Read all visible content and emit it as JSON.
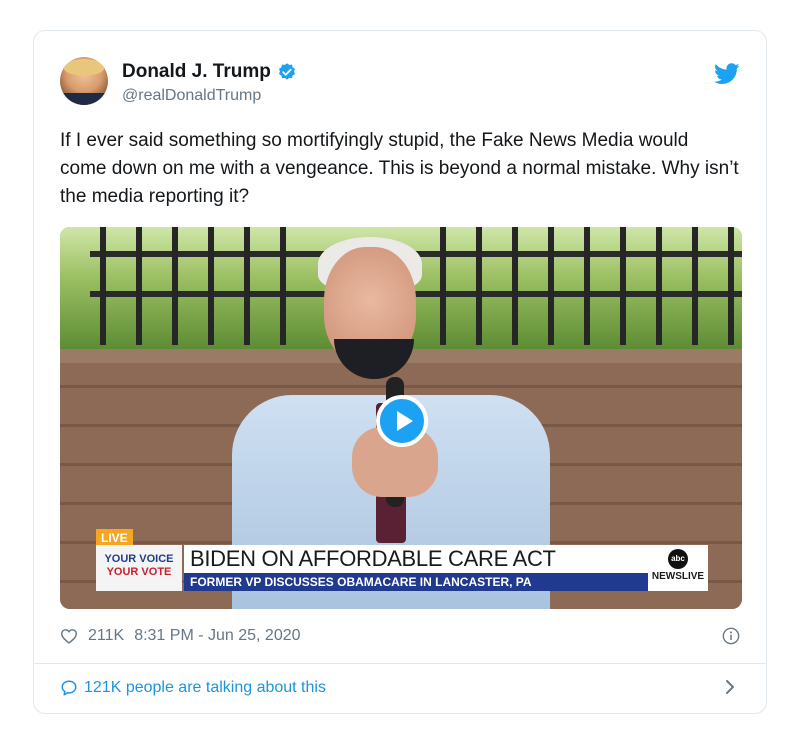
{
  "author": {
    "name": "Donald J. Trump",
    "handle": "@realDonaldTrump",
    "verified": true
  },
  "tweet": {
    "text": "If I ever said something so mortifyingly stupid, the Fake News Media would come down on me with a vengeance. This is beyond a normal mistake. Why isn’t the media reporting it?"
  },
  "video": {
    "live_badge": "LIVE",
    "brand_line1": "YOUR VOICE",
    "brand_line2": "YOUR VOTE",
    "headline": "BIDEN ON AFFORDABLE CARE ACT",
    "subline": "FORMER VP DISCUSSES OBAMACARE IN LANCASTER, PA",
    "network_logo": "abc",
    "network_label": "NEWSLIVE"
  },
  "footer": {
    "likes": "211K",
    "timestamp": "8:31 PM - Jun 25, 2020",
    "talking": "121K people are talking about this"
  },
  "colors": {
    "twitter_blue": "#1da1f2",
    "link_blue": "#1b95e0",
    "secondary_text": "#657786"
  },
  "icons": {
    "verified": "verified-badge-icon",
    "bird": "twitter-bird-icon",
    "heart": "heart-icon",
    "info": "info-icon",
    "comment": "comment-bubble-icon",
    "chevron": "chevron-right-icon",
    "play": "play-icon"
  }
}
